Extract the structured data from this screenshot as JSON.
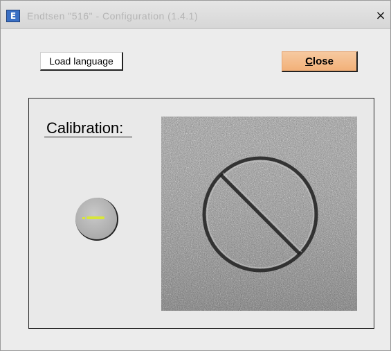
{
  "window": {
    "title": "Endtsen \"516\" - Configuration (1.4.1)",
    "app_icon": "E",
    "close_glyph": "×"
  },
  "toolbar": {
    "load_language_label": "Load language",
    "close_label_mnemonic": "C",
    "close_label_rest": "lose"
  },
  "panel": {
    "calibration_label": "Calibration:",
    "image_icon": "no-entry-sign-icon"
  },
  "colors": {
    "close_button": "#f2b078",
    "knob_indicator": "#d8e63a",
    "window_bg": "#ececec"
  }
}
